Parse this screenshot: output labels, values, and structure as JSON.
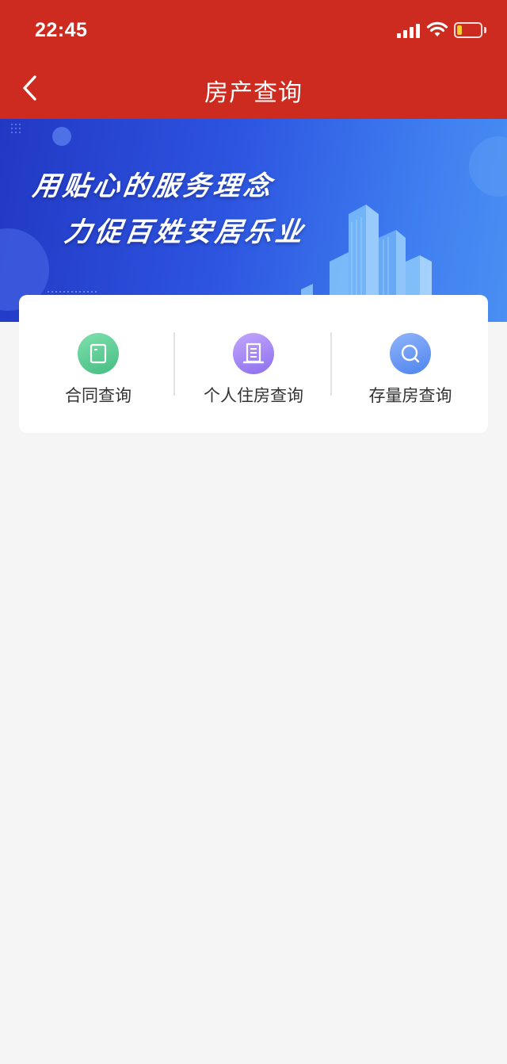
{
  "status_bar": {
    "time": "22:45"
  },
  "nav": {
    "title": "房产查询"
  },
  "banner": {
    "slogan_line1": "用贴心的服务理念",
    "slogan_line2": "力促百姓安居乐业"
  },
  "menu": {
    "items": [
      {
        "label": "合同查询",
        "icon": "contract-icon",
        "color": "#4fc48c"
      },
      {
        "label": "个人住房查询",
        "icon": "building-icon",
        "color": "#9a7ff0"
      },
      {
        "label": "存量房查询",
        "icon": "search-icon",
        "color": "#5a8ff0"
      }
    ]
  },
  "colors": {
    "header": "#cd2b1f",
    "page_bg": "#f5f5f5"
  }
}
